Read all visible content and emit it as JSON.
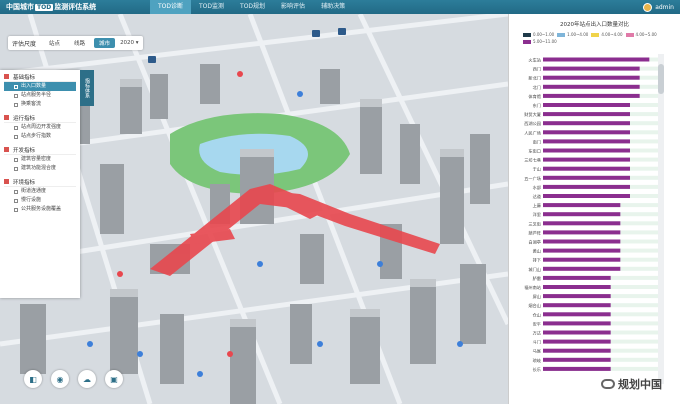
{
  "header": {
    "brand_pre": "中国城市",
    "brand_tod": "TOD",
    "brand_post": "监测评估系统",
    "nav": [
      "TOD诊断",
      "TOD监测",
      "TOD规划",
      "影响评估",
      "辅助决策"
    ],
    "user": "admin"
  },
  "filter": {
    "label": "评估尺度",
    "options": [
      "站点",
      "线路",
      "城市"
    ],
    "active": "城市",
    "year": "2020"
  },
  "left_panel": {
    "tab_label": "指标体系",
    "groups": [
      {
        "title": "基础指标",
        "items": [
          "出入口数量",
          "站点服务半径",
          "换乘客流"
        ]
      },
      {
        "title": "运行指标",
        "items": [
          "站点周边开发强度",
          "站点步行指数"
        ]
      },
      {
        "title": "开发指标",
        "items": [
          "建筑容量密度",
          "建筑功能混合度"
        ]
      },
      {
        "title": "环境指标",
        "items": [
          "街道连通度",
          "慢行设施",
          "公共服务设施覆盖"
        ]
      }
    ],
    "active_item": "出入口数量"
  },
  "tools": [
    "layers-icon",
    "location-icon",
    "cloud-icon",
    "screen-icon"
  ],
  "chart": {
    "title": "2020年站点出入口数量对比",
    "legend": [
      "0.00~1.00",
      "1.00~4.00",
      "4.00~4.00",
      "4.00~5.00",
      "5.00~11.00"
    ]
  },
  "chart_data": {
    "type": "bar",
    "orientation": "horizontal",
    "title": "2020年站点出入口数量对比",
    "categories": [
      "火车站",
      "西门",
      "新北门",
      "北门",
      "体育馆",
      "东门",
      "财贸大厦",
      "西湖公园",
      "人民广场",
      "南门",
      "东街口",
      "三坊七巷",
      "于山",
      "五一广场",
      "水部",
      "达道",
      "上藤",
      "洋里",
      "三叉街",
      "葫芦阵",
      "白湖亭",
      "黄山",
      "排下",
      "城门山",
      "胪雷",
      "福州南站",
      "屏山",
      "烟台山",
      "仓山",
      "安平",
      "万达",
      "斗门",
      "马尾",
      "琅岐",
      "长乐"
    ],
    "values": [
      11,
      10,
      10,
      10,
      10,
      9,
      9,
      9,
      9,
      9,
      9,
      9,
      9,
      9,
      9,
      9,
      8,
      8,
      8,
      8,
      8,
      8,
      8,
      8,
      7,
      7,
      7,
      7,
      7,
      7,
      7,
      7,
      7,
      7,
      7
    ],
    "xlim": [
      0,
      12
    ],
    "bar_color": "#8b2e8f",
    "bg_bar_color": "#e8f4ec"
  },
  "watermark": "规划中国",
  "colors": {
    "topbar": "#226a86",
    "accent": "#3d8fae",
    "route": "#e8474e",
    "park": "#7bc67a"
  }
}
